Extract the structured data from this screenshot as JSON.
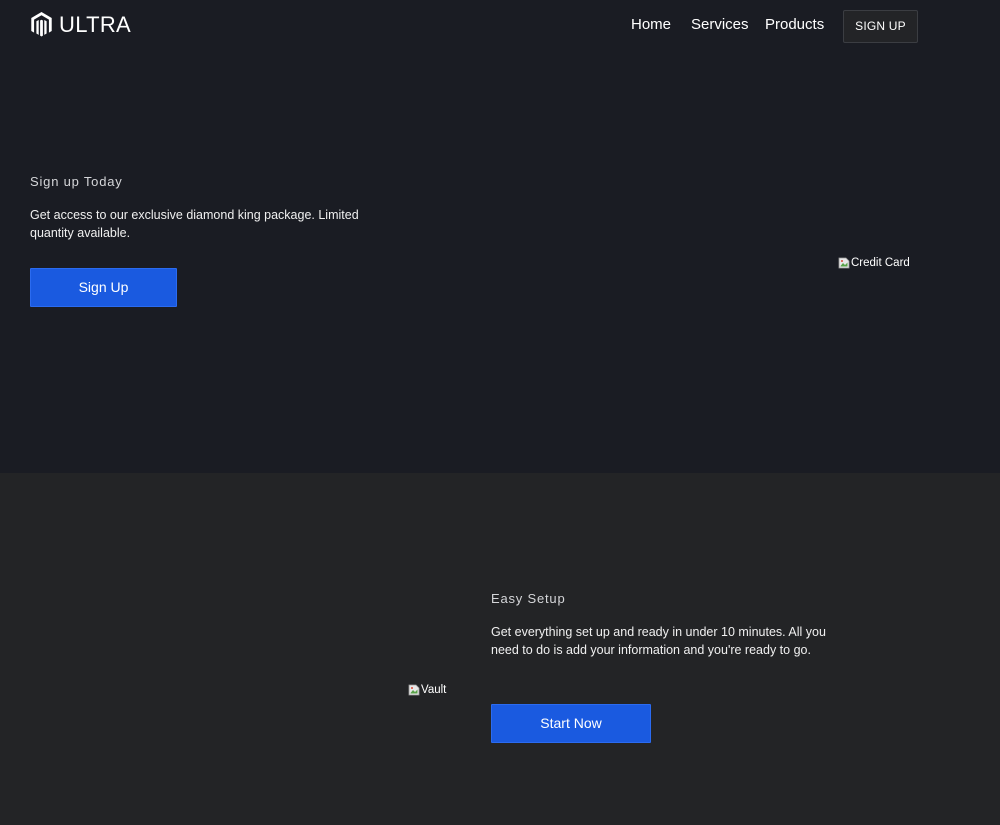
{
  "colors": {
    "hero_background": "#1a1c23",
    "features_background": "#232426",
    "accent_button": "#1a5ae0",
    "text": "#ffffff"
  },
  "navbar": {
    "logo_icon": "magento-icon",
    "brand": "ULTRA",
    "links": [
      "Home",
      "Services",
      "Products"
    ],
    "signup_label": "SIGN UP"
  },
  "hero": {
    "title": "Sign up Today",
    "text": "Get access to our exclusive diamond king package. Limited quantity available.",
    "button_label": "Sign Up",
    "image_alt": "Credit Card",
    "image_icon": "broken-image-icon"
  },
  "features": {
    "image_alt": "Vault",
    "image_icon": "broken-image-icon",
    "title": "Easy Setup",
    "text": "Get everything set up and ready in under 10 minutes. All you need to do is add your information and you're ready to go.",
    "button_label": "Start Now"
  }
}
